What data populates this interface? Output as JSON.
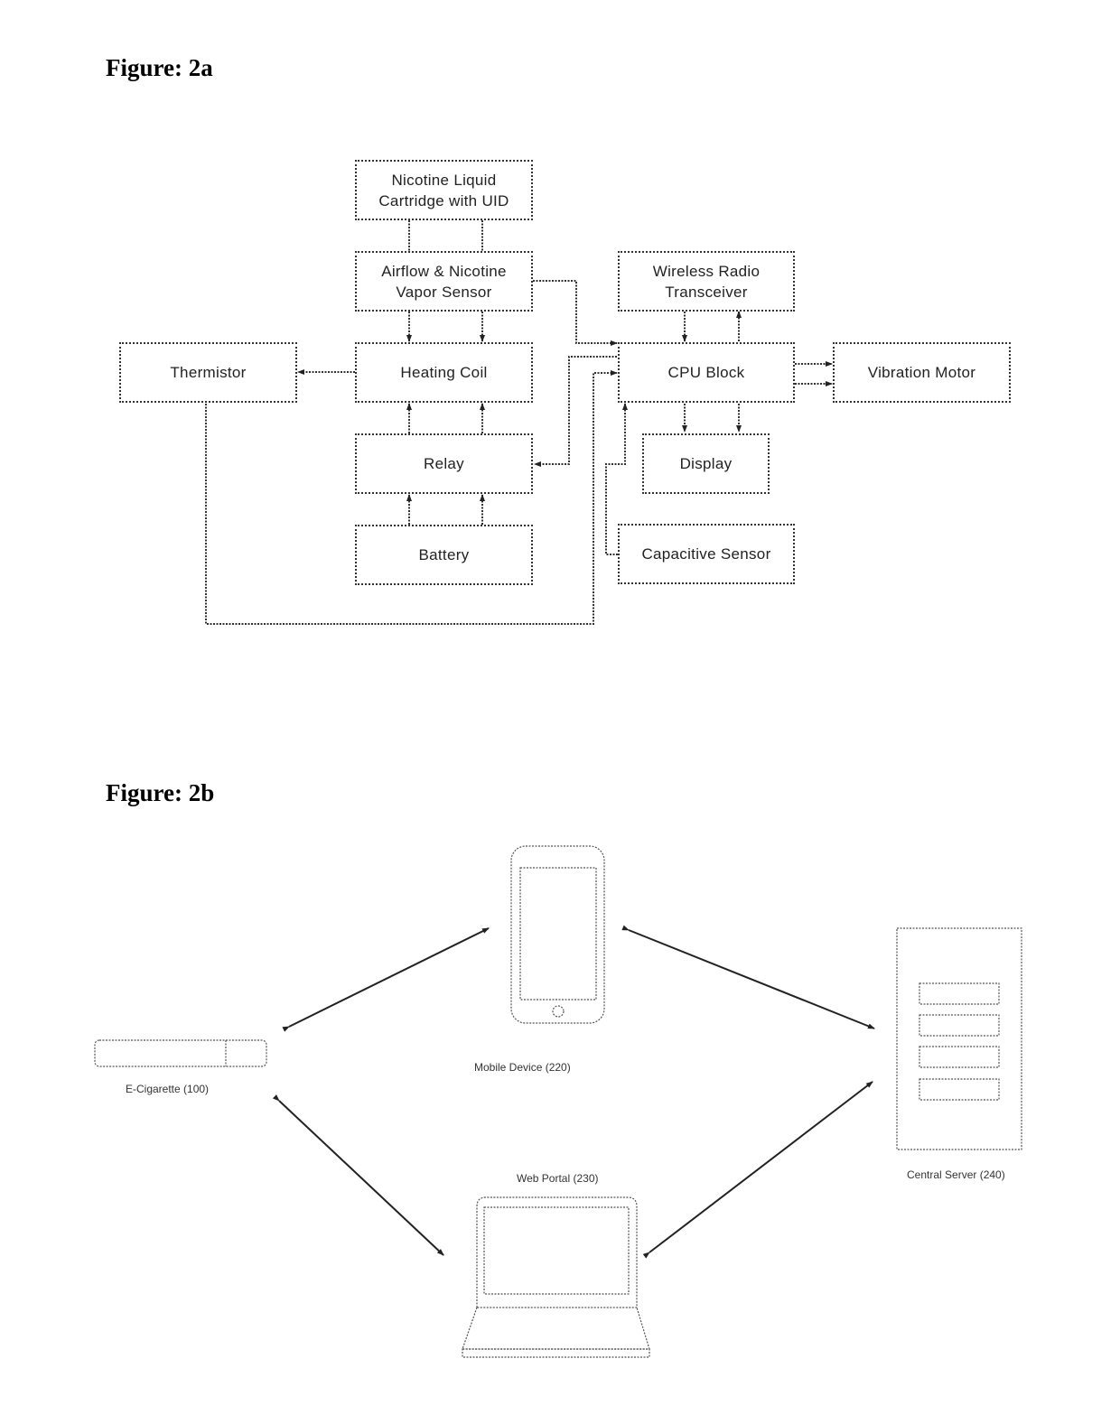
{
  "figure_2a": {
    "title": "Figure: 2a",
    "blocks": {
      "cartridge": [
        "Nicotine Liquid",
        "Cartridge with UID"
      ],
      "airflow_sensor": [
        "Airflow & Nicotine",
        "Vapor Sensor"
      ],
      "heating_coil": "Heating Coil",
      "relay": "Relay",
      "battery": "Battery",
      "thermistor": "Thermistor",
      "wireless_radio": [
        "Wireless Radio",
        "Transceiver"
      ],
      "cpu_block": "CPU Block",
      "vibration_motor": "Vibration Motor",
      "display": "Display",
      "capacitive_sensor": "Capacitive Sensor"
    },
    "connections": [
      {
        "from": "cartridge",
        "to": "airflow_sensor",
        "type": "double-line"
      },
      {
        "from": "airflow_sensor",
        "to": "heating_coil",
        "type": "double-arrow-down"
      },
      {
        "from": "airflow_sensor",
        "to": "cpu_block",
        "type": "arrow"
      },
      {
        "from": "heating_coil",
        "to": "thermistor",
        "type": "arrow"
      },
      {
        "from": "relay",
        "to": "heating_coil",
        "type": "double-arrow-up"
      },
      {
        "from": "battery",
        "to": "relay",
        "type": "double-arrow-up"
      },
      {
        "from": "cpu_block",
        "to": "relay",
        "type": "arrow"
      },
      {
        "from": "thermistor",
        "to": "cpu_block",
        "type": "arrow"
      },
      {
        "from": "wireless_radio",
        "to": "cpu_block",
        "type": "arrow"
      },
      {
        "from": "cpu_block",
        "to": "wireless_radio",
        "type": "arrow"
      },
      {
        "from": "cpu_block",
        "to": "vibration_motor",
        "type": "double-arrow"
      },
      {
        "from": "cpu_block",
        "to": "display",
        "type": "double-arrow-down"
      },
      {
        "from": "capacitive_sensor",
        "to": "cpu_block",
        "type": "arrow"
      }
    ]
  },
  "figure_2b": {
    "title": "Figure: 2b",
    "nodes": {
      "e_cigarette": "E-Cigarette (100)",
      "mobile_device": "Mobile Device (220)",
      "web_portal": "Web Portal (230)",
      "central_server": "Central Server (240)"
    },
    "links": [
      {
        "a": "e_cigarette",
        "b": "mobile_device",
        "type": "bidirectional"
      },
      {
        "a": "mobile_device",
        "b": "central_server",
        "type": "bidirectional"
      },
      {
        "a": "e_cigarette",
        "b": "web_portal",
        "type": "bidirectional"
      },
      {
        "a": "web_portal",
        "b": "central_server",
        "type": "bidirectional"
      }
    ]
  }
}
